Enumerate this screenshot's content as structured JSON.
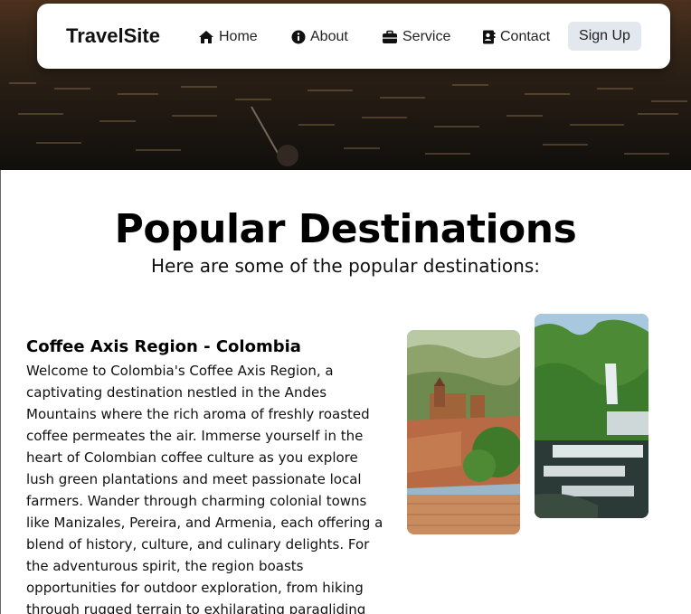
{
  "navbar": {
    "brand": "TravelSite",
    "items": [
      {
        "label": "Home",
        "icon": "home-icon"
      },
      {
        "label": "About",
        "icon": "info-icon"
      },
      {
        "label": "Service",
        "icon": "briefcase-icon"
      },
      {
        "label": "Contact",
        "icon": "contact-card-icon"
      }
    ],
    "signup_label": "Sign Up"
  },
  "main": {
    "title": "Popular Destinations",
    "subtitle": "Here are some of the popular destinations:"
  },
  "destination": {
    "name": "Coffee Axis Region - Colombia",
    "description": "Welcome to Colombia's Coffee Axis Region, a captivating destination nestled in the Andes Mountains where the rich aroma of freshly roasted coffee permeates the air. Immerse yourself in the heart of Colombian coffee culture as you explore lush green plantations and meet passionate local farmers. Wander through charming colonial towns like Manizales, Pereira, and Armenia, each offering a blend of history, culture, and culinary delights. For the adventurous spirit, the region boasts opportunities for outdoor exploration, from hiking through rugged terrain to exhilarating paragliding experiences. Whether you're a coffee"
  },
  "colors": {
    "navbar_bg": "#ffffff",
    "signup_bg": "#e3e7ee",
    "hero_dark": "#1d1a14"
  }
}
